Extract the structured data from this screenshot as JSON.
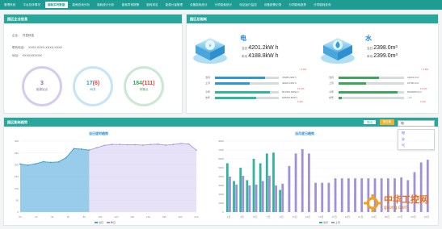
{
  "tabs": [
    "管理系统",
    "平台总体情况",
    "能耗实时数据",
    "能耗查询分析",
    "能耗统计分析",
    "能耗异常报警",
    "能耗排名",
    "能源计量管理",
    "设备能耗统计",
    "分项能耗统计",
    "电站运行监控",
    "设备报警记录",
    "分项能耗趋势",
    "分项能耗查询"
  ],
  "left": {
    "heading": "园区企业信息",
    "name_label": "企业：",
    "name_value": "开发科技",
    "phone_label": "联系电话：",
    "phone_value": "XXXX-XXXX-XXXX-XXXX",
    "addr_label": "地址：",
    "addr_value": "XXXXXXXXXX",
    "stats": [
      {
        "value": "3",
        "label": "能源站点",
        "color": "#7e6ab5"
      },
      {
        "value": "17",
        "extra": "(6)",
        "label": "网关",
        "color": "#2c9fd8"
      },
      {
        "value": "184",
        "extra": "(111)",
        "label": "采集点",
        "color": "#3ca65b"
      }
    ]
  },
  "right": {
    "heading": "园区总能耗",
    "blocks": [
      {
        "title": "电",
        "today_label": "当日",
        "today_value": "4201.2kW h",
        "month_label": "本月",
        "month_value": "4188.8kW h",
        "trend": "↑ 0.3%",
        "rows": [
          {
            "label": "当月",
            "value": "70695.2kW h",
            "fill": 0.78,
            "color": "#2e97d8"
          },
          {
            "label": "上月",
            "value": "40921.2kW h",
            "fill": 0.55,
            "color": "#2e97d8"
          },
          {
            "label": "今年",
            "value": "847033.18kW h",
            "fill": 0.86,
            "color": "#31b7a0",
            "pct": "17.6%"
          },
          {
            "label": "去年",
            "value": "628333.6kW h",
            "fill": 0.64,
            "color": "#31b7a0",
            "pct": "2.3%"
          }
        ]
      },
      {
        "title": "水",
        "today_label": "当日",
        "today_value": "2398.0m³",
        "month_label": "本月",
        "month_value": "2399.0m³",
        "trend": "↑ 0.5%",
        "rows": [
          {
            "label": "当月",
            "value": "41013.0m³",
            "fill": 0.62,
            "color": "#3ca65b"
          },
          {
            "label": "上月",
            "value": "24790.0m³",
            "fill": 0.42,
            "color": "#3ca65b"
          },
          {
            "label": "今年",
            "value": "5040086.0m³",
            "fill": 0.9,
            "color": "#3ca65b",
            "pct": "17.6%"
          },
          {
            "label": "去年",
            "value": "--m³",
            "fill": 0.05,
            "color": "#3ca65b",
            "pct": "2.3%"
          }
        ]
      }
    ]
  },
  "bottom": {
    "heading": "园区能耗趋势",
    "buttons": [
      "导出",
      "按日期"
    ],
    "dropdown_value": "电",
    "dropdown_options": [
      "电",
      "水",
      "气"
    ],
    "chart_left_title": "当日逐时趋势",
    "chart_right_title": "当月逐日趋势",
    "legend_left": [
      "当日",
      "昨日"
    ],
    "legend_right": [
      "当月",
      "上月"
    ]
  },
  "watermark": {
    "main": "中华工控网",
    "sub": "gkong.com"
  },
  "chart_data": [
    {
      "type": "area",
      "title": "当日逐时趋势",
      "ylim": [
        0,
        300
      ],
      "yticks": [
        "300",
        "250",
        "200",
        "150",
        "100",
        "50",
        "0"
      ],
      "xticks": [
        "0h",
        "2h",
        "4h",
        "6h",
        "8h",
        "10h",
        "12h",
        "14h",
        "16h",
        "18h",
        "20h",
        "22h"
      ],
      "series": [
        {
          "name": "当日",
          "color": "#3aa8cf",
          "values": [
            203,
            198,
            204,
            213,
            210,
            212,
            230,
            268,
            266,
            262,
            null,
            null,
            null,
            null,
            null,
            null,
            null,
            null,
            null,
            null,
            null,
            null,
            null,
            null
          ]
        },
        {
          "name": "昨日",
          "color": "#a18fd8",
          "values": [
            203,
            198,
            204,
            213,
            210,
            212,
            230,
            268,
            266,
            262,
            272,
            282,
            286,
            286,
            285,
            285,
            283,
            286,
            287,
            283,
            286,
            290,
            288,
            262
          ]
        }
      ]
    },
    {
      "type": "bar",
      "title": "当月逐日趋势",
      "ylim": [
        0,
        8000
      ],
      "yticks": [
        "8000",
        "7000",
        "6000",
        "5000",
        "4000",
        "3000",
        "2000",
        "1000",
        "0"
      ],
      "xticks": [
        "1日",
        "3日",
        "5日",
        "7日",
        "9日",
        "11日",
        "13日",
        "15日",
        "17日",
        "19日",
        "21日",
        "23日",
        "25日",
        "27日",
        "29日",
        "31日"
      ],
      "series": [
        {
          "name": "当月",
          "color": "#2fb59e",
          "values": [
            5500,
            3500,
            5000,
            3600,
            6000,
            5500,
            6600,
            6700,
            2500
          ]
        },
        {
          "name": "上月",
          "color": "#a18fd8",
          "values": [
            4000,
            3100,
            4100,
            3000,
            3100,
            3500,
            4100,
            3000,
            3200,
            5200,
            6600,
            7100,
            6600,
            3300,
            3300,
            3300,
            3800,
            3800,
            3800,
            3800,
            3800,
            3800,
            3800,
            3800,
            3800,
            3800,
            3900,
            3600,
            4500,
            5600,
            5900
          ]
        }
      ]
    }
  ]
}
